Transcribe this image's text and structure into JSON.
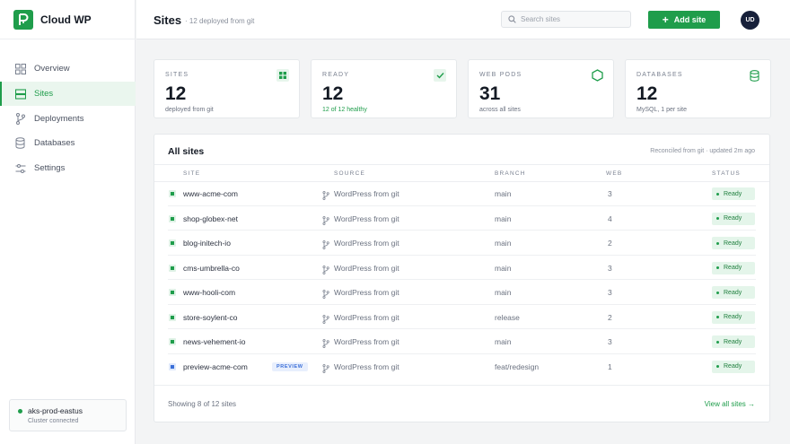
{
  "app": {
    "name": "Cloud WP"
  },
  "nav": [
    {
      "label": "Overview",
      "icon": "grid-icon"
    },
    {
      "label": "Sites",
      "icon": "rows-icon",
      "active": true
    },
    {
      "label": "Deployments",
      "icon": "git-branch-icon"
    },
    {
      "label": "Databases",
      "icon": "database-icon"
    },
    {
      "label": "Settings",
      "icon": "sliders-icon"
    }
  ],
  "cluster": {
    "name": "aks-prod-eastus",
    "status": "Cluster connected"
  },
  "header": {
    "title": "Sites",
    "subtitle": "· 12 deployed from git",
    "search_placeholder": "Search sites",
    "add_label": "Add site",
    "avatar": "UD"
  },
  "stats": [
    {
      "label": "SITES",
      "value": "12",
      "sub": "deployed from git",
      "icon": "grid-icon"
    },
    {
      "label": "READY",
      "value": "12",
      "sub": "12 of 12 healthy",
      "icon": "check-icon"
    },
    {
      "label": "WEB PODS",
      "value": "31",
      "sub": "across all sites",
      "icon": "hexagon-icon"
    },
    {
      "label": "DATABASES",
      "value": "12",
      "sub": "MySQL, 1 per site",
      "icon": "database-icon"
    }
  ],
  "table": {
    "title": "All sites",
    "meta": "Reconciled from git · updated 2m ago",
    "columns": [
      "SITE",
      "SOURCE",
      "BRANCH",
      "WEB",
      "STATUS"
    ],
    "rows": [
      {
        "site": "www-acme-com",
        "source": "WordPress from git",
        "branch": "main",
        "web": "3",
        "status": "Ready"
      },
      {
        "site": "shop-globex-net",
        "source": "WordPress from git",
        "branch": "main",
        "web": "4",
        "status": "Ready"
      },
      {
        "site": "blog-initech-io",
        "source": "WordPress from git",
        "branch": "main",
        "web": "2",
        "status": "Ready"
      },
      {
        "site": "cms-umbrella-co",
        "source": "WordPress from git",
        "branch": "main",
        "web": "3",
        "status": "Ready"
      },
      {
        "site": "www-hooli-com",
        "source": "WordPress from git",
        "branch": "main",
        "web": "3",
        "status": "Ready"
      },
      {
        "site": "store-soylent-co",
        "source": "WordPress from git",
        "branch": "release",
        "web": "2",
        "status": "Ready"
      },
      {
        "site": "news-vehement-io",
        "source": "WordPress from git",
        "branch": "main",
        "web": "3",
        "status": "Ready"
      },
      {
        "site": "preview-acme-com",
        "badge": "PREVIEW",
        "source": "WordPress from git",
        "branch": "feat/redesign",
        "web": "1",
        "status": "Ready"
      }
    ],
    "footer_count": "Showing 8 of 12 sites",
    "footer_link": "View all sites →"
  },
  "colors": {
    "accent": "#1f9d4b",
    "preview": "#3b6fd8",
    "avatar": "#17203a"
  }
}
